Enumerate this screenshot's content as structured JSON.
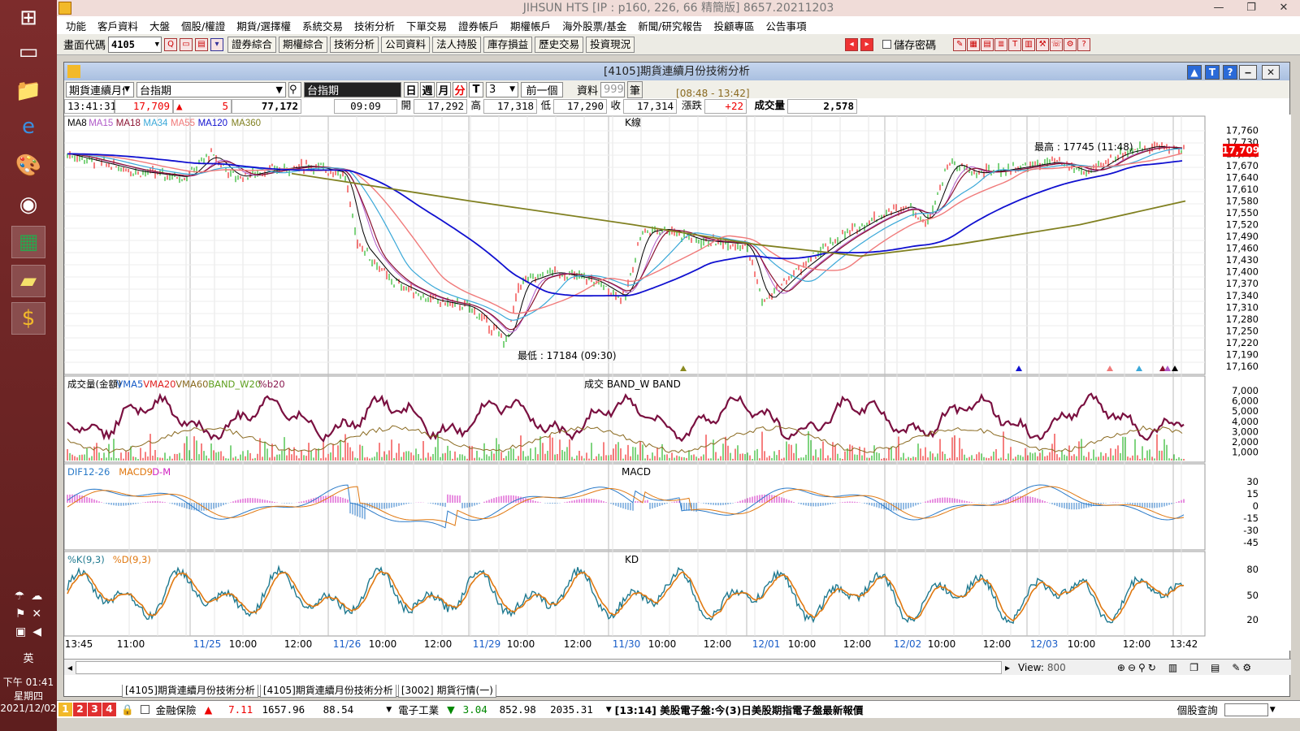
{
  "taskbar": {
    "time": "下午 01:41",
    "weekday": "星期四",
    "date": "2021/12/02",
    "ime": "英"
  },
  "titlebar": {
    "title": "JIHSUN HTS    [IP : p160, 226, 66 精簡版] 8657.20211203"
  },
  "menu": [
    "功能",
    "客戶資料",
    "大盤",
    "個股/權證",
    "期貨/選擇權",
    "系統交易",
    "技術分析",
    "下單交易",
    "證券帳戶",
    "期權帳戶",
    "海外股票/基金",
    "新聞/研究報告",
    "投顧專區",
    "公告事項"
  ],
  "toolbar": {
    "code_label": "畫面代碼",
    "code_value": "4105",
    "buttons": [
      "證券綜合",
      "期權綜合",
      "技術分析",
      "公司資料",
      "法人持股",
      "庫存損益",
      "歷史交易",
      "投資現況"
    ],
    "save_pwd": "儲存密碼"
  },
  "subwindow": {
    "title": "[4105]期貨連續月份技術分析",
    "product_type": "期貨連續月份",
    "product": "台指期",
    "product_name": "台指期",
    "periods": [
      "日",
      "週",
      "月",
      "分",
      "T"
    ],
    "period_value": "3",
    "prev_btn": "前一個",
    "data_label": "資料",
    "data_count": "999",
    "unit": "筆",
    "time_range": "[08:48 - 13:42]"
  },
  "quote": {
    "time": "13:41:31",
    "price": "17,709",
    "change": "5",
    "volume_total": "77,172",
    "bar_time": "09:09",
    "open_label": "開",
    "open": "17,292",
    "high_label": "高",
    "high": "17,318",
    "low_label": "低",
    "low": "17,290",
    "close_label": "收",
    "close": "17,314",
    "chg_label": "漲跌",
    "chg": "+22",
    "vol_label": "成交量",
    "vol": "2,578"
  },
  "panels": {
    "price": {
      "legend": [
        "MA8",
        "MA15",
        "MA18",
        "MA34",
        "MA55",
        "MA120",
        "MA360"
      ],
      "legend_colors": [
        "#000000",
        "#b05ac8",
        "#8a1030",
        "#3aa8d8",
        "#f07a7a",
        "#1010d0",
        "#808020"
      ],
      "tag": "K線",
      "high_note": "最高 : 17745 (11:48)",
      "low_note": "最低 : 17184 (09:30)",
      "last": "17,709",
      "yticks": [
        "17,760",
        "17,730",
        "17,700",
        "17,670",
        "17,640",
        "17,610",
        "17,580",
        "17,550",
        "17,520",
        "17,490",
        "17,460",
        "17,430",
        "17,400",
        "17,370",
        "17,340",
        "17,310",
        "17,280",
        "17,250",
        "17,220",
        "17,190",
        "17,160"
      ]
    },
    "volume": {
      "legend": [
        "成交量(金額)",
        "VMA5",
        "VMA20",
        "VMA60",
        "BAND_W20",
        "%b20"
      ],
      "legend_colors": [
        "#000000",
        "#1a5ec8",
        "#e02020",
        "#8a6a20",
        "#60a020",
        "#8a1a50"
      ],
      "tag": "成交  BAND_W  BAND",
      "yticks": [
        "7,000",
        "6,000",
        "5,000",
        "4,000",
        "3,000",
        "2,000",
        "1,000"
      ]
    },
    "macd": {
      "legend": [
        "DIF12-26",
        "MACD9",
        "D-M"
      ],
      "legend_colors": [
        "#2a7ac8",
        "#e07810",
        "#d020c0"
      ],
      "tag": "MACD",
      "yticks": [
        "30",
        "15",
        "0",
        "-15",
        "-30",
        "-45"
      ]
    },
    "kd": {
      "legend": [
        "%K(9,3)",
        "%D(9,3)"
      ],
      "legend_colors": [
        "#207a90",
        "#e07810"
      ],
      "tag": "KD",
      "yticks": [
        "80",
        "50",
        "20"
      ]
    }
  },
  "xaxis": [
    {
      "t": "13:45",
      "day": false
    },
    {
      "t": "11:00",
      "day": false
    },
    {
      "t": "11/25",
      "day": true
    },
    {
      "t": "10:00",
      "day": false
    },
    {
      "t": "12:00",
      "day": false
    },
    {
      "t": "11/26",
      "day": true
    },
    {
      "t": "10:00",
      "day": false
    },
    {
      "t": "12:00",
      "day": false
    },
    {
      "t": "11/29",
      "day": true
    },
    {
      "t": "10:00",
      "day": false
    },
    {
      "t": "12:00",
      "day": false
    },
    {
      "t": "11/30",
      "day": true
    },
    {
      "t": "10:00",
      "day": false
    },
    {
      "t": "12:00",
      "day": false
    },
    {
      "t": "12/01",
      "day": true
    },
    {
      "t": "10:00",
      "day": false
    },
    {
      "t": "12:00",
      "day": false
    },
    {
      "t": "12/02",
      "day": true
    },
    {
      "t": "10:00",
      "day": false
    },
    {
      "t": "12:00",
      "day": false
    },
    {
      "t": "12/03",
      "day": true
    },
    {
      "t": "10:00",
      "day": false
    },
    {
      "t": "12:00",
      "day": false
    },
    {
      "t": "13:42",
      "day": false
    }
  ],
  "scroll": {
    "view_label": "View:",
    "view_value": "800"
  },
  "tabs": [
    "[4105]期貨連續月份技術分析",
    "[4105]期貨連續月份技術分析",
    "[3002] 期貨行情(一)"
  ],
  "status": {
    "pages": [
      "1",
      "2",
      "3",
      "4"
    ],
    "sector1": "金融保險",
    "sector1_chg": "7.11",
    "sector1_idx": "1657.96",
    "sector1_vol": "88.54",
    "sector2": "電子工業",
    "sector2_chg": "3.04",
    "sector2_idx": "852.98",
    "sector2_vol": "2035.31",
    "news": "[13:14] 美股電子盤:今(3)日美股期指電子盤最新報價",
    "right_label": "個股查詢"
  }
}
